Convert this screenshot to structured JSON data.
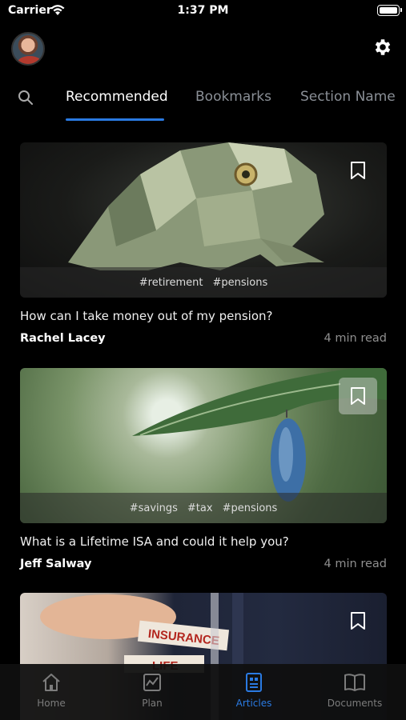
{
  "status_bar": {
    "carrier": "Carrier",
    "time": "1:37 PM"
  },
  "header": {
    "avatar": "avatar",
    "settings_icon": "gear-icon"
  },
  "tabs": {
    "search_icon": "search-icon",
    "items": [
      {
        "label": "Recommended",
        "active": true
      },
      {
        "label": "Bookmarks",
        "active": false
      },
      {
        "label": "Section Name",
        "active": false
      }
    ]
  },
  "articles": [
    {
      "title": "How can I take money out of my pension?",
      "author": "Rachel Lacey",
      "read_time": "4 min read",
      "tags": [
        "#retirement",
        "#pensions"
      ],
      "image": "origami-money-frog",
      "bookmarked_style": "outline"
    },
    {
      "title": "What is a Lifetime ISA and could it help you?",
      "author": "Jeff Salway",
      "read_time": "4 min read",
      "tags": [
        "#savings",
        "#tax",
        "#pensions"
      ],
      "image": "chrysalis-on-leaf",
      "bookmarked_style": "filled-bg"
    },
    {
      "title": "",
      "author": "",
      "read_time": "",
      "tags": [],
      "image": "insurance-blocks",
      "image_text": [
        "INSURANCE",
        "LIFE"
      ],
      "bookmarked_style": "outline"
    }
  ],
  "tab_bar": {
    "items": [
      {
        "label": "Home",
        "icon": "home-icon",
        "active": false
      },
      {
        "label": "Plan",
        "icon": "chart-icon",
        "active": false
      },
      {
        "label": "Articles",
        "icon": "articles-icon",
        "active": true
      },
      {
        "label": "Documents",
        "icon": "book-icon",
        "active": false
      }
    ]
  },
  "colors": {
    "accent": "#2a7ae2",
    "background": "#000000",
    "muted": "#8f8f8f"
  }
}
